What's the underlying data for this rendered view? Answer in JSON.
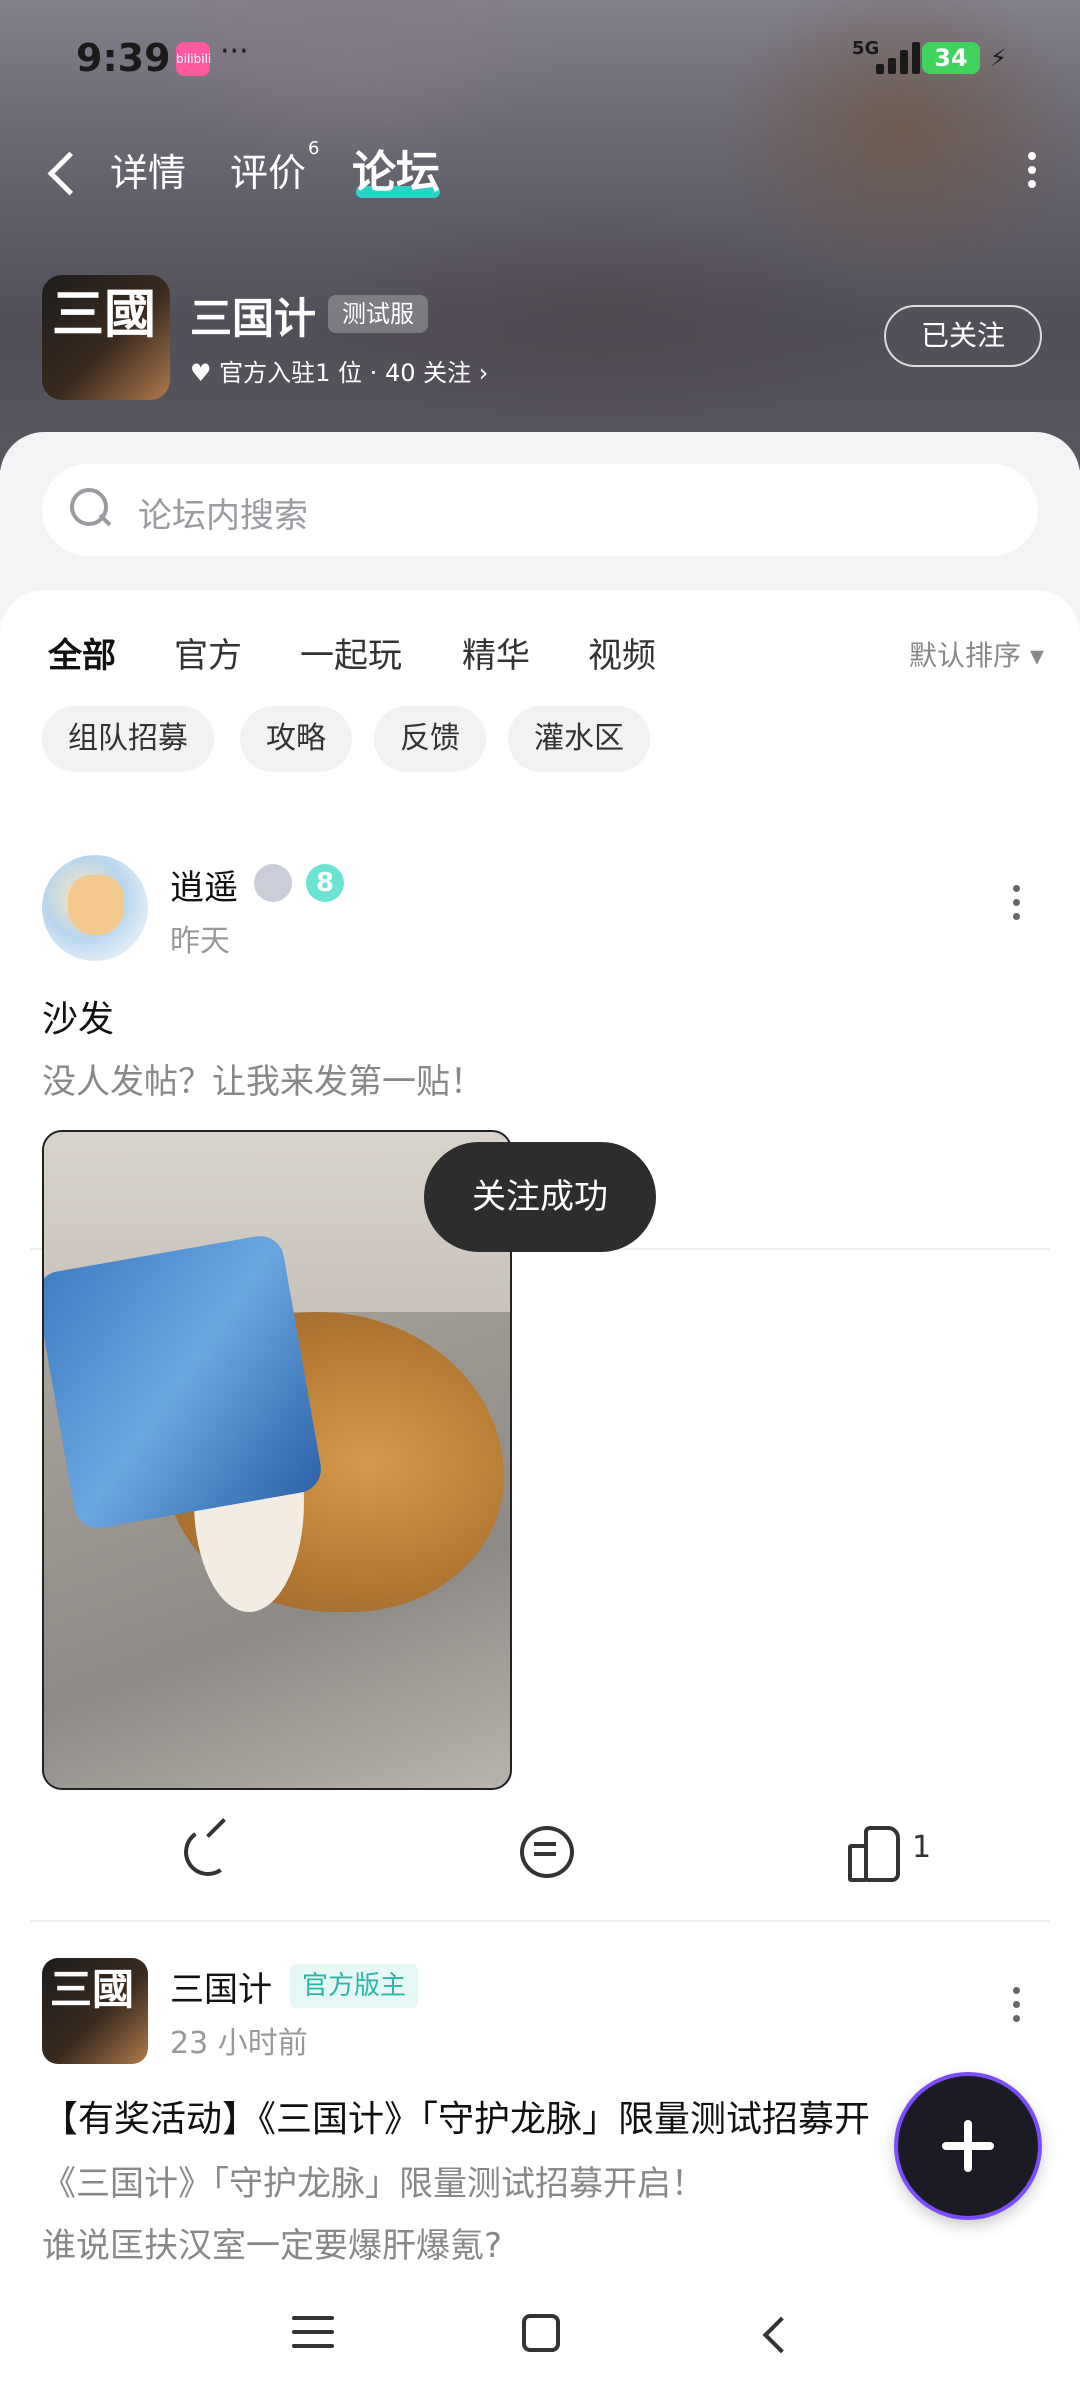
{
  "status_bar": {
    "time": "9:39",
    "app_badge": "bilibili",
    "dots": "···",
    "network": "5G",
    "battery": "34"
  },
  "top_nav": {
    "tabs": [
      {
        "label": "详情"
      },
      {
        "label": "评价",
        "badge": "6"
      },
      {
        "label": "论坛"
      }
    ]
  },
  "game": {
    "logo_text": "三國",
    "name": "三国计",
    "server_badge": "测试服",
    "meta": "官方入驻1 位 · 40 关注 ›",
    "follow_label": "已关注"
  },
  "search": {
    "placeholder": "论坛内搜索"
  },
  "feed_tabs": [
    "全部",
    "官方",
    "一起玩",
    "精华",
    "视频"
  ],
  "sort_label": "默认排序 ▾",
  "chips": [
    "组队招募",
    "攻略",
    "反馈",
    "灌水区"
  ],
  "posts": [
    {
      "author": "逍遥",
      "level": "8",
      "time": "昨天",
      "title": "沙发",
      "body": "没人发帖？让我来发第一贴！",
      "likes": "1"
    },
    {
      "author": "三国计",
      "avatar_text": "三國",
      "tag": "官方版主",
      "time": "23 小时前",
      "title": "【有奖活动】《三国计》「守护龙脉」限量测试招募开",
      "body_line1": "《三国计》「守护龙脉」限量测试招募开启！",
      "body_line2": "谁说匡扶汉室一定要爆肝爆氪?"
    }
  ],
  "toast": "关注成功",
  "colors": {
    "accent": "#2ad3c6",
    "fab_ring": "#7c4cff"
  }
}
